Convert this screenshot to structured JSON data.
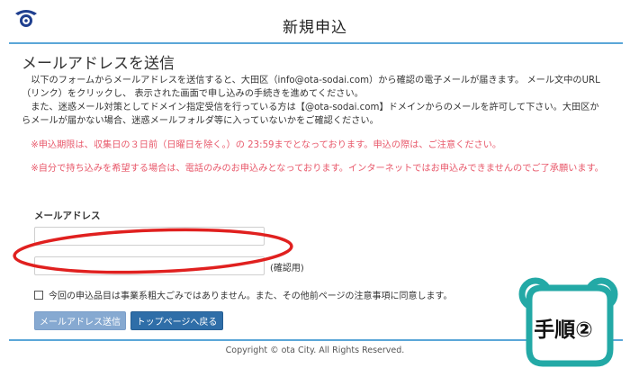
{
  "header": {
    "title": "新規申込"
  },
  "section": {
    "title": "メールアドレスを送信"
  },
  "description": {
    "paragraph1": "以下のフォームからメールアドレスを送信すると、大田区（info@ota-sodai.com）から確認の電子メールが届きます。 メール文中のURL（リンク）をクリックし、 表示された画面で申し込みの手続きを進めてください。",
    "paragraph2": "また、迷惑メール対策としてドメイン指定受信を行っている方は【@ota-sodai.com】ドメインからのメールを許可して下さい。大田区からメールが届かない場合、迷惑メールフォルダ等に入っていないかをご確認ください。"
  },
  "notices": {
    "deadline": "※申込期限は、収集日の３日前（日曜日を除く。）の 23:59までとなっております。申込の際は、ご注意ください。",
    "self_delivery": "※自分で持ち込みを希望する場合は、電話のみのお申込みとなっております。インターネットではお申込みできませんのでご了承願います。"
  },
  "form": {
    "email_label": "メールアドレス",
    "email_value": "",
    "confirm_value": "",
    "confirm_label": "(確認用)",
    "agree_label": "今回の申込品目は事業系粗大ごみではありません。また、その他前ページの注意事項に同意します。",
    "agree_checked": false
  },
  "buttons": {
    "send": "メールアドレス送信",
    "top": "トップページへ戻る"
  },
  "footer": {
    "copyright": "Copyright © ota City. All Rights Reserved."
  },
  "badge": {
    "label": "手順②"
  },
  "colors": {
    "accent_rule": "#5ba7d8",
    "notice_red": "#e8596b",
    "highlight_red": "#e0201f",
    "badge_teal": "#23a9a6",
    "send_button": "#86a9d1",
    "top_button": "#2f6ea8"
  }
}
